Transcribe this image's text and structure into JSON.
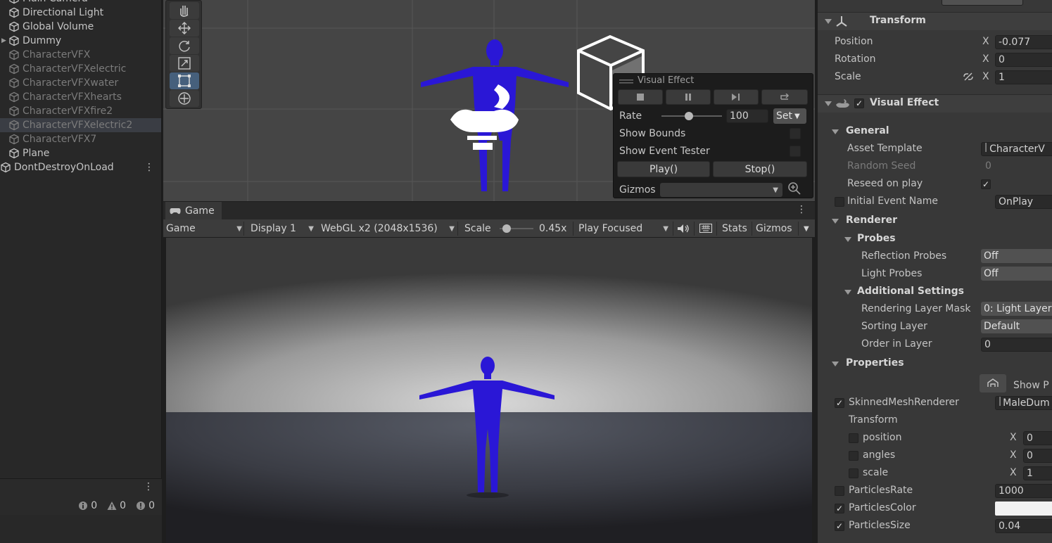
{
  "hierarchy": {
    "items": [
      {
        "label": "Main Camera",
        "disabled": false
      },
      {
        "label": "Directional Light",
        "disabled": false
      },
      {
        "label": "Global Volume",
        "disabled": false
      },
      {
        "label": "Dummy",
        "disabled": false
      },
      {
        "label": "CharacterVFX",
        "disabled": true
      },
      {
        "label": "CharacterVFXelectric",
        "disabled": true
      },
      {
        "label": "CharacterVFXwater",
        "disabled": true
      },
      {
        "label": "CharacterVFXhearts",
        "disabled": true
      },
      {
        "label": "CharacterVFXfire2",
        "disabled": true
      },
      {
        "label": "CharacterVFXelectric2",
        "disabled": true,
        "selected": true
      },
      {
        "label": "CharacterVFX7",
        "disabled": true
      },
      {
        "label": "Plane",
        "disabled": false
      }
    ],
    "scene_root": "DontDestroyOnLoad"
  },
  "console": {
    "log_count": "0",
    "warning_count": "0",
    "error_count": "0"
  },
  "vfx_panel": {
    "title": "Visual Effect",
    "rate_label": "Rate",
    "rate_value": "100",
    "rate_fraction": 0.45,
    "set_label": "Set",
    "show_bounds": "Show Bounds",
    "show_event_tester": "Show Event Tester",
    "play_label": "Play()",
    "stop_label": "Stop()",
    "gizmos_label": "Gizmos"
  },
  "game": {
    "tab_label": "Game",
    "mode": "Game",
    "display": "Display 1",
    "resolution": "WebGL x2 (2048x1536)",
    "scale_label": "Scale",
    "scale_value": "0.45x",
    "scale_fraction": 0.1,
    "play_mode": "Play Focused",
    "stats": "Stats",
    "gizmos": "Gizmos"
  },
  "inspector": {
    "transform": {
      "title": "Transform",
      "position_label": "Position",
      "position_x": "-0.077",
      "rotation_label": "Rotation",
      "rotation_x": "0",
      "scale_label": "Scale",
      "scale_x": "1",
      "x": "X"
    },
    "visual_effect": {
      "title": "Visual Effect",
      "general": "General",
      "asset_template_label": "Asset Template",
      "asset_template_value": "CharacterV",
      "random_seed_label": "Random Seed",
      "random_seed_value": "0",
      "reseed_label": "Reseed on play",
      "initial_event_label": "Initial Event Name",
      "initial_event_value": "OnPlay",
      "renderer": "Renderer",
      "probes": "Probes",
      "reflection_probes_label": "Reflection Probes",
      "reflection_probes_value": "Off",
      "light_probes_label": "Light Probes",
      "light_probes_value": "Off",
      "additional_settings": "Additional Settings",
      "rendering_layer_mask_label": "Rendering Layer Mask",
      "rendering_layer_mask_value": "0: Light Layer",
      "sorting_layer_label": "Sorting Layer",
      "sorting_layer_value": "Default",
      "order_in_layer_label": "Order in Layer",
      "order_in_layer_value": "0",
      "properties": "Properties",
      "show_label": "Show P",
      "skinned_label": "SkinnedMeshRenderer",
      "skinned_value": "MaleDum",
      "transform_sub": "Transform",
      "position_sub": "position",
      "position_sub_x": "0",
      "angles_sub": "angles",
      "angles_sub_x": "0",
      "scale_sub": "scale",
      "scale_sub_x": "1",
      "particles_rate_label": "ParticlesRate",
      "particles_rate_value": "1000",
      "particles_color_label": "ParticlesColor",
      "particles_size_label": "ParticlesSize",
      "particles_size_value": "0.04"
    }
  },
  "colors": {
    "character": "#2a17d6",
    "selection": "#3a3d44",
    "accent": "#46607c"
  }
}
